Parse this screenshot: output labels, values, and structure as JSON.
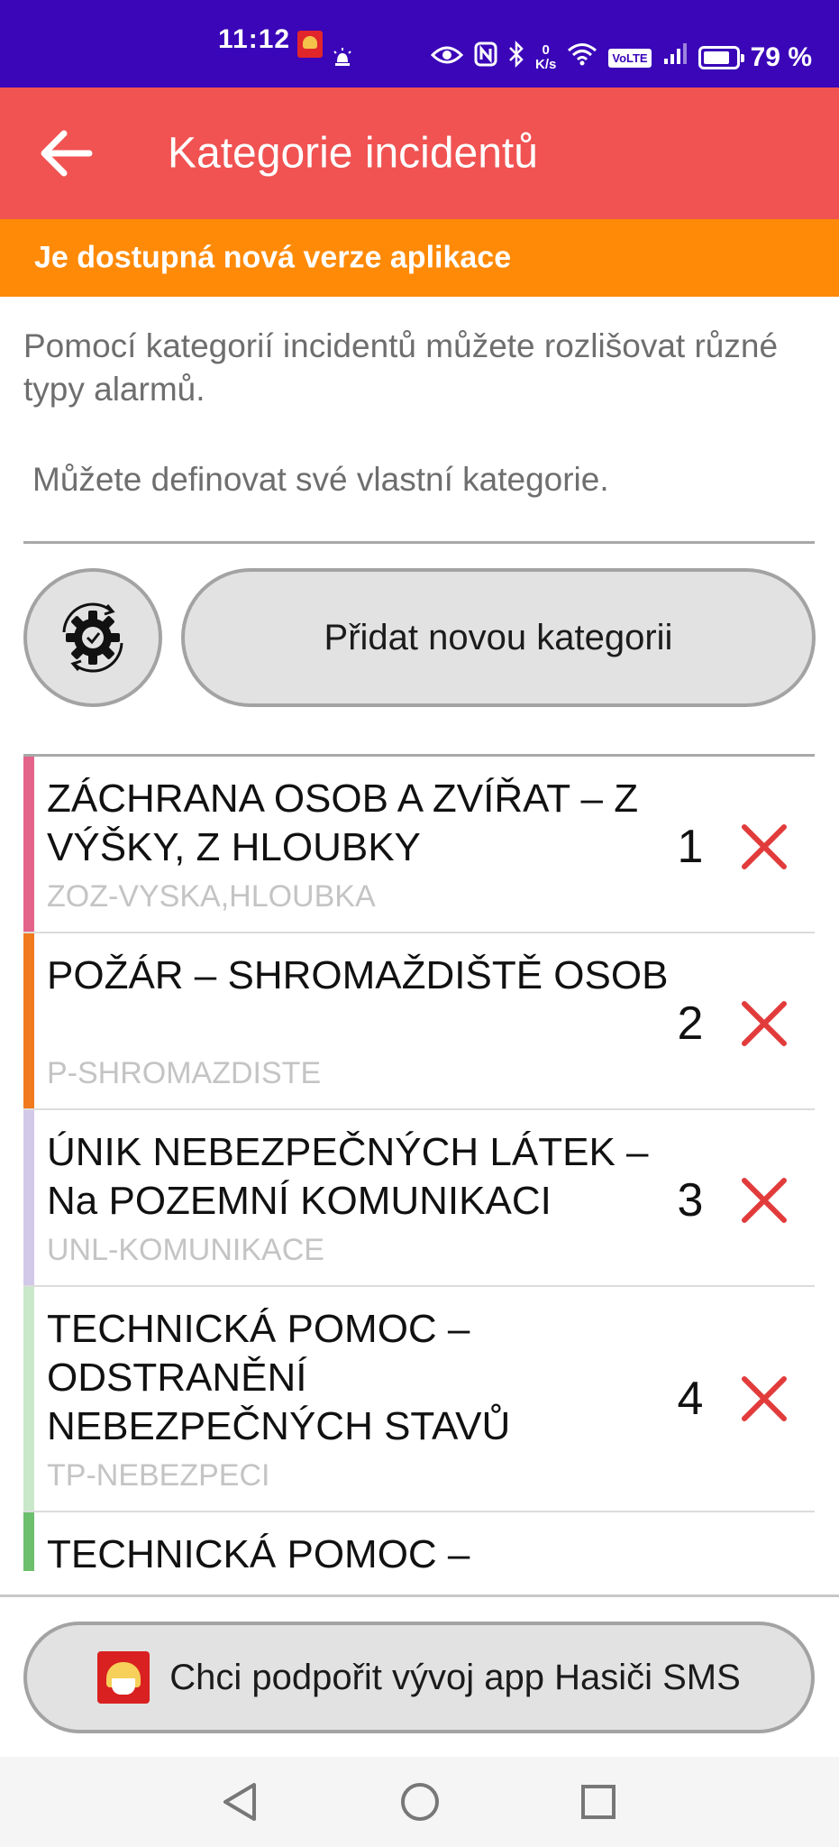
{
  "status_bar": {
    "time": "11:12",
    "net_speed_value": "0",
    "net_speed_unit": "K/s",
    "volte": "VoLTE",
    "battery": "79 %"
  },
  "app_bar": {
    "title": "Kategorie incidentů",
    "back_icon": "arrow-left-icon"
  },
  "banner": {
    "text": "Je dostupná nová verze aplikace",
    "color": "#ff8a07"
  },
  "intro": {
    "line1": "Pomocí kategorií incidentů můžete rozlišovat různé typy alarmů.",
    "line2": "Můžete definovat své vlastní kategorie."
  },
  "actions": {
    "settings_icon": "gear-sync-icon",
    "add_label": "Přidat novou kategorii"
  },
  "categories": [
    {
      "name": "ZÁCHRANA OSOB A ZVÍŘAT – Z VÝŠKY, Z HLOUBKY",
      "code": "ZOZ-VYSKA,HLOUBKA",
      "number": "1",
      "color": "#e4638b"
    },
    {
      "name": "POŽÁR – SHROMAŽDIŠTĚ OSOB",
      "code": "P-SHROMAZDISTE",
      "number": "2",
      "color": "#f07a1d"
    },
    {
      "name": "ÚNIK NEBEZPEČNÝCH LÁTEK – Na POZEMNÍ KOMUNIKACI",
      "code": "UNL-KOMUNIKACE",
      "number": "3",
      "color": "#d2c9e8"
    },
    {
      "name": "TECHNICKÁ POMOC – ODSTRANĚNÍ NEBEZPEČNÝCH STAVŮ",
      "code": "TP-NEBEZPECI",
      "number": "4",
      "color": "#c9e8c9"
    },
    {
      "name": "TECHNICKÁ POMOC –",
      "code": "",
      "number": "",
      "color": "#6cbf6c"
    }
  ],
  "support": {
    "label": "Chci podpořit vývoj app Hasiči SMS"
  },
  "colors": {
    "status_bar": "#3a06b8",
    "app_bar": "#f15252",
    "delete": "#e23b3b"
  }
}
